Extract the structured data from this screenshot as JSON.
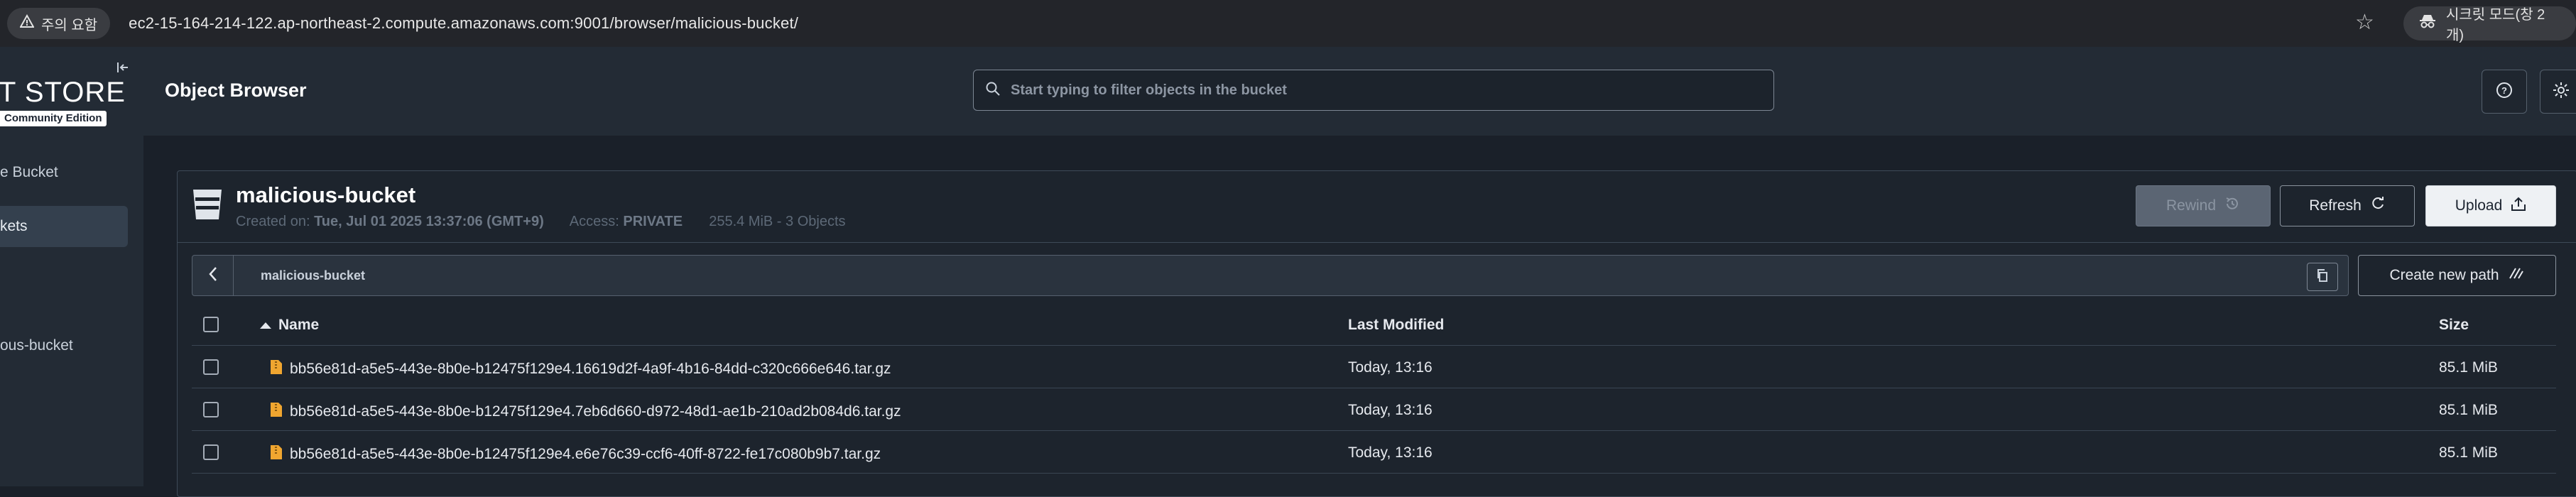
{
  "browser": {
    "warning_label": "주의 요함",
    "url": "ec2-15-164-214-122.ap-northeast-2.compute.amazonaws.com:9001/browser/malicious-bucket/",
    "incognito_label": "시크릿 모드(창 2개)"
  },
  "sidebar": {
    "logo_text": "T STORE",
    "logo_edition": "Community Edition",
    "items": [
      {
        "label": "e Bucket"
      },
      {
        "label": "kets"
      },
      {
        "label": "ous-bucket"
      }
    ]
  },
  "header": {
    "title": "Object Browser",
    "search_placeholder": "Start typing to filter objects in the bucket"
  },
  "bucket": {
    "name": "malicious-bucket",
    "created_label": "Created on:",
    "created_value": "Tue, Jul 01 2025 13:37:06 (GMT+9)",
    "access_label": "Access:",
    "access_value": "PRIVATE",
    "summary": "255.4 MiB - 3 Objects"
  },
  "actions": {
    "rewind_label": "Rewind",
    "refresh_label": "Refresh",
    "upload_label": "Upload",
    "create_path_label": "Create new path"
  },
  "path": {
    "current": "malicious-bucket"
  },
  "table": {
    "columns": {
      "name": "Name",
      "modified": "Last Modified",
      "size": "Size"
    },
    "rows": [
      {
        "name": "bb56e81d-a5e5-443e-8b0e-b12475f129e4.16619d2f-4a9f-4b16-84dd-c320c666e646.tar.gz",
        "modified": "Today, 13:16",
        "size": "85.1 MiB"
      },
      {
        "name": "bb56e81d-a5e5-443e-8b0e-b12475f129e4.7eb6d660-d972-48d1-ae1b-210ad2b084d6.tar.gz",
        "modified": "Today, 13:16",
        "size": "85.1 MiB"
      },
      {
        "name": "bb56e81d-a5e5-443e-8b0e-b12475f129e4.e6e76c39-ccf6-40ff-8722-fe17c080b9b7.tar.gz",
        "modified": "Today, 13:16",
        "size": "85.1 MiB"
      }
    ]
  },
  "colors": {
    "background": "#1a2029",
    "header": "#232b35",
    "file_icon": "#f0a630",
    "upload_button": "#eef1f4"
  },
  "icons": {
    "warning": "warning-triangle-icon",
    "star": "star-icon",
    "incognito": "incognito-icon",
    "search": "search-icon",
    "help": "help-icon",
    "theme": "sun-icon",
    "bucket": "bucket-icon",
    "rewind": "rewind-icon",
    "refresh": "refresh-icon",
    "upload": "upload-icon",
    "back": "chevron-left-icon",
    "copy": "copy-icon",
    "create_path": "new-path-icon",
    "file": "file-archive-icon"
  }
}
